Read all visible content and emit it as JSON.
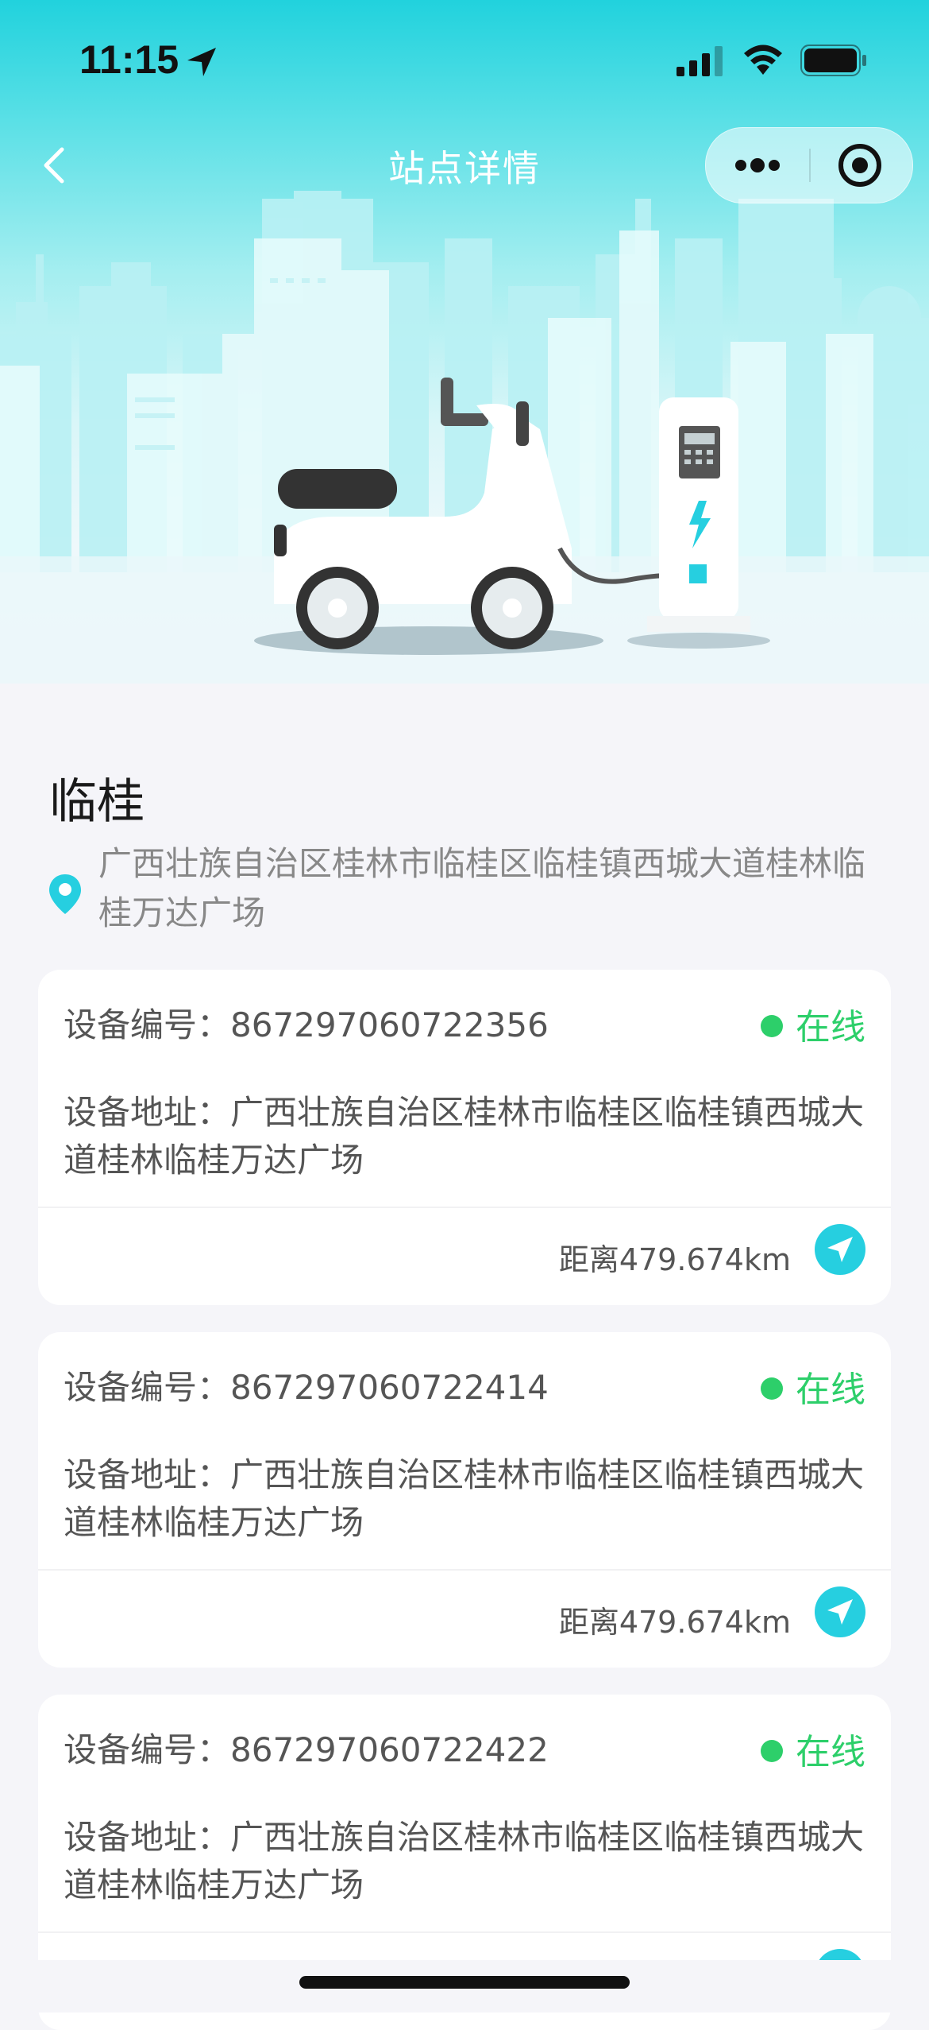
{
  "status_bar": {
    "time": "11:15",
    "icons": [
      "location-arrow-icon",
      "signal-icon",
      "wifi-icon",
      "battery-icon"
    ]
  },
  "nav": {
    "title": "站点详情",
    "back_icon": "chevron-left-icon",
    "more_icon": "more-dots-icon",
    "close_icon": "target-circle-icon"
  },
  "station": {
    "name": "临桂",
    "address": "广西壮族自治区桂林市临桂区临桂镇西城大道桂林临桂万达广场",
    "pin_icon": "map-pin-icon"
  },
  "devices": [
    {
      "id_label": "设备编号：867297060722356",
      "status": "在线",
      "address_label": "设备地址：广西壮族自治区桂林市临桂区临桂镇西城大道桂林临桂万达广场",
      "distance": "距离479.674km"
    },
    {
      "id_label": "设备编号：867297060722414",
      "status": "在线",
      "address_label": "设备地址：广西壮族自治区桂林市临桂区临桂镇西城大道桂林临桂万达广场",
      "distance": "距离479.674km"
    },
    {
      "id_label": "设备编号：867297060722422",
      "status": "在线",
      "address_label": "设备地址：广西壮族自治区桂林市临桂区临桂镇西城大道桂林临桂万达广场",
      "distance": ""
    }
  ],
  "colors": {
    "accent": "#26cfe0",
    "online": "#2dcf6a",
    "page_bg": "#f5f5f9"
  }
}
